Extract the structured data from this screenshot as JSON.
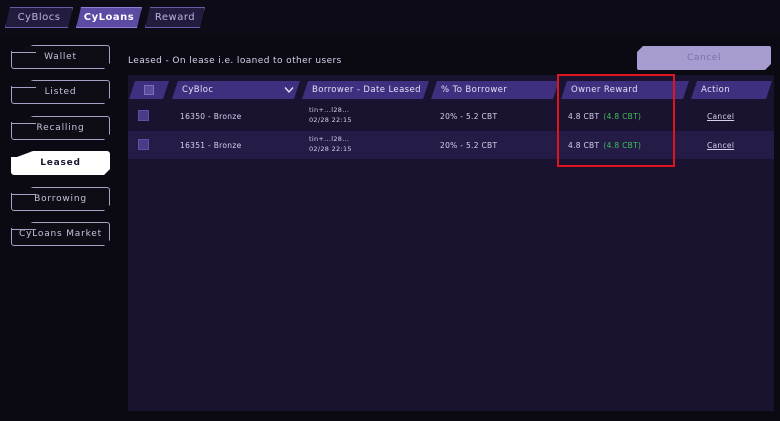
{
  "tabs": [
    {
      "label": "CyBlocs",
      "active": false
    },
    {
      "label": "CyLoans",
      "active": true
    },
    {
      "label": "Reward",
      "active": false
    }
  ],
  "sidebar": {
    "items": [
      {
        "label": "Wallet",
        "active": false
      },
      {
        "label": "Listed",
        "active": false
      },
      {
        "label": "Recalling",
        "active": false
      },
      {
        "label": "Leased",
        "active": true
      },
      {
        "label": "Borrowing",
        "active": false
      },
      {
        "label": "CyLoans Market",
        "active": false
      }
    ]
  },
  "main": {
    "heading": "Leased - On lease i.e. loaned to other users",
    "cancel_label": "Cancel",
    "table": {
      "columns": [
        "CyBloc",
        "Borrower - Date Leased",
        "% To Borrower",
        "Owner Reward",
        "Action"
      ],
      "rows": [
        {
          "cybloc": "16350 - Bronze",
          "borrower": "tin+...l28...",
          "date": "02/28 22:15",
          "percent": "20% - 5.2 CBT",
          "owner_reward": "4.8 CBT",
          "owner_reward_extra": "(4.8 CBT)",
          "action": "Cancel"
        },
        {
          "cybloc": "16351 - Bronze",
          "borrower": "tin+...l28...",
          "date": "02/28 22:15",
          "percent": "20% - 5.2 CBT",
          "owner_reward": "4.8 CBT",
          "owner_reward_extra": "(4.8 CBT)",
          "action": "Cancel"
        }
      ]
    }
  },
  "colors": {
    "accent": "#5c4aa3",
    "header_bg": "#3f2f7e",
    "highlight": "#e0141c",
    "reward_green": "#3fbf58"
  }
}
